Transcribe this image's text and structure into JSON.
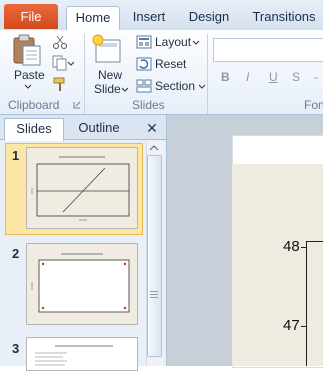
{
  "tabs": {
    "file": "File",
    "home": "Home",
    "insert": "Insert",
    "design": "Design",
    "transitions": "Transitions"
  },
  "ribbon": {
    "clipboard": {
      "label": "Clipboard",
      "paste": "Paste"
    },
    "slides": {
      "label": "Slides",
      "new_slide_line1": "New",
      "new_slide_line2": "Slide",
      "layout": "Layout",
      "reset": "Reset",
      "section": "Section"
    },
    "font": {
      "label": "Fon",
      "bold": "B",
      "italic": "I",
      "underline": "U",
      "strike": "S"
    }
  },
  "pane": {
    "tab_slides": "Slides",
    "tab_outline": "Outline",
    "close": "✕",
    "slides": [
      {
        "num": "1"
      },
      {
        "num": "2"
      },
      {
        "num": "3"
      }
    ]
  },
  "main": {
    "axis_ticks": [
      "48",
      "47"
    ]
  },
  "colors": {
    "file_tab": "#d24a1d",
    "selection": "#fde7a5",
    "plot_bg": "#efebe1"
  }
}
